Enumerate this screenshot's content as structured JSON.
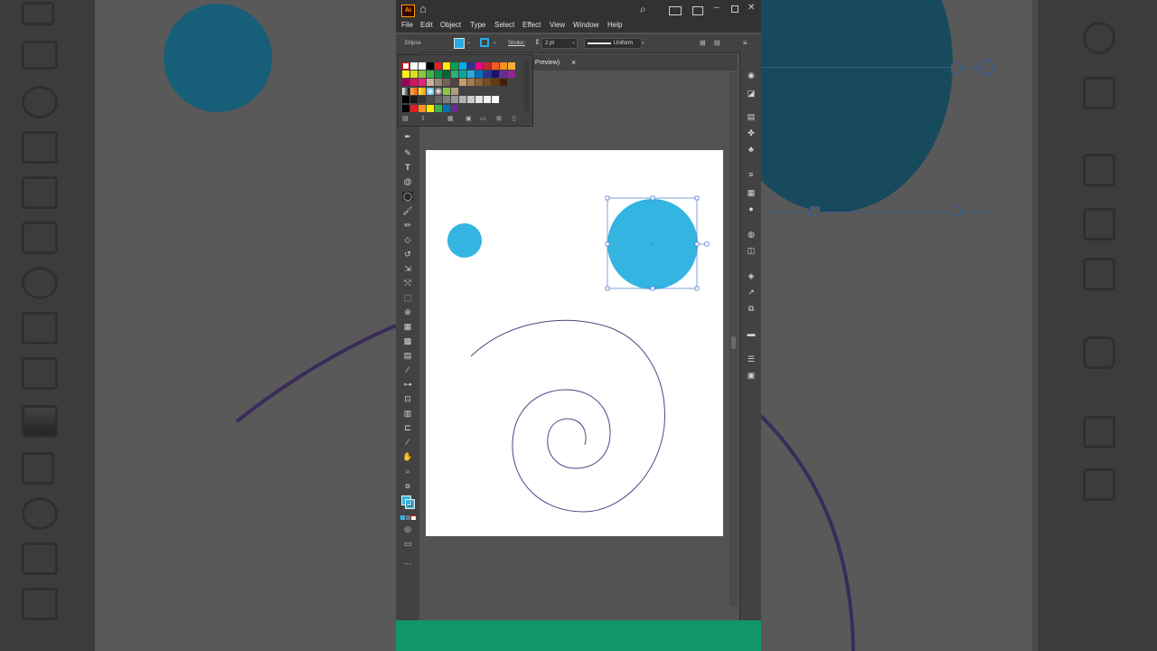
{
  "app": {
    "logo_text": "Ai",
    "menu": [
      "File",
      "Edit",
      "Object",
      "Type",
      "Select",
      "Effect",
      "View",
      "Window",
      "Help"
    ]
  },
  "control_bar": {
    "object_type": "Ellipse",
    "stroke_label": "Stroke:",
    "stroke_weight": "2 pt",
    "profile_label": "Uniform",
    "fill_color": "#29abe2",
    "stroke_color": "#29abe2"
  },
  "document_tab": {
    "label": "/ Preview)",
    "close": "×"
  },
  "colors": {
    "accent_blue": "#33b4e1",
    "spiral": "#5b3f82",
    "status_green": "#11956a"
  },
  "icons": {
    "home": "home-icon",
    "search": "search-icon",
    "arrange": "arrange-icon",
    "minimize": "minimize-icon",
    "maximize": "maximize-icon",
    "close": "close-icon"
  }
}
